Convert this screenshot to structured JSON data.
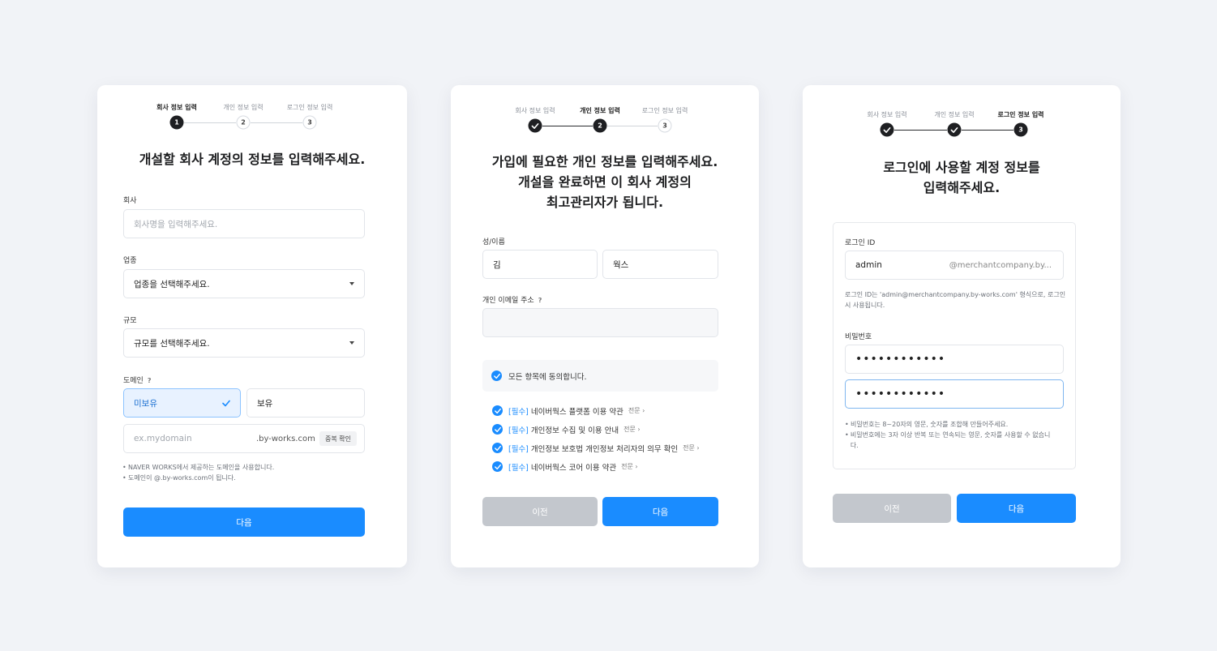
{
  "steps": [
    "회사 정보 입력",
    "개인 정보 입력",
    "로그인 정보 입력"
  ],
  "step_numbers": [
    "1",
    "2",
    "3"
  ],
  "card1": {
    "title": "개설할 회사 계정의 정보를 입력해주세요.",
    "company": {
      "label": "회사",
      "placeholder": "회사명을 입력해주세요."
    },
    "industry": {
      "label": "업종",
      "value": "업종을 선택해주세요."
    },
    "size": {
      "label": "규모",
      "value": "규모를 선택해주세요."
    },
    "domain": {
      "label": "도메인",
      "help": "?",
      "option_none": "미보유",
      "option_owned": "보유",
      "placeholder": "ex.mydomain",
      "suffix": ".by-works.com",
      "check_button": "중복 확인"
    },
    "notes": [
      "NAVER WORKS에서 제공하는 도메인을 사용합니다.",
      "도메인이 @.by-works.com이 됩니다."
    ],
    "next_button": "다음"
  },
  "card2": {
    "title_lines": [
      "가입에 필요한 개인 정보를 입력해주세요.",
      "개설을 완료하면 이 회사 계정의",
      "최고관리자가 됩니다."
    ],
    "name": {
      "label": "성/이름",
      "last": "김",
      "first": "웍스"
    },
    "email": {
      "label": "개인 이메일 주소",
      "help": "?"
    },
    "agree_all": "모든 항목에 동의합니다.",
    "required_tag": "[필수]",
    "full_text": "전문",
    "terms": [
      "네이버웍스 플랫폼 이용 약관",
      "개인정보 수집 및 이용 안내",
      "개인정보 보호법 개인정보 처리자의 의무 확인",
      "네이버웍스 코어 이용 약관"
    ],
    "prev_button": "이전",
    "next_button": "다음"
  },
  "card3": {
    "title_lines": [
      "로그인에 사용할 계정 정보를",
      "입력해주세요."
    ],
    "login_id": {
      "label": "로그인 ID",
      "value": "admin",
      "suffix": "@merchantcompany.by...",
      "hint": "로그인 ID는 'admin@merchantcompany.by-works.com' 형식으로, 로그인 시 사용됩니다."
    },
    "password": {
      "label": "비밀번호",
      "mask1": "••••••••••••",
      "mask2": "••••••••••••",
      "notes": [
        "비밀번호는 8~20자의 영문, 숫자를 조합해 만들어주세요.",
        "비밀번호에는 3자 이상 반복 또는 연속되는 영문, 숫자를 사용할 수 없습니다."
      ]
    },
    "prev_button": "이전",
    "next_button": "다음"
  },
  "colors": {
    "accent": "#1a8cff",
    "disabled": "#c3c7cd",
    "selected_bg": "#e8f2ff"
  },
  "icons": [
    "checkmark-icon",
    "caret-down-icon",
    "chevron-right-icon"
  ]
}
